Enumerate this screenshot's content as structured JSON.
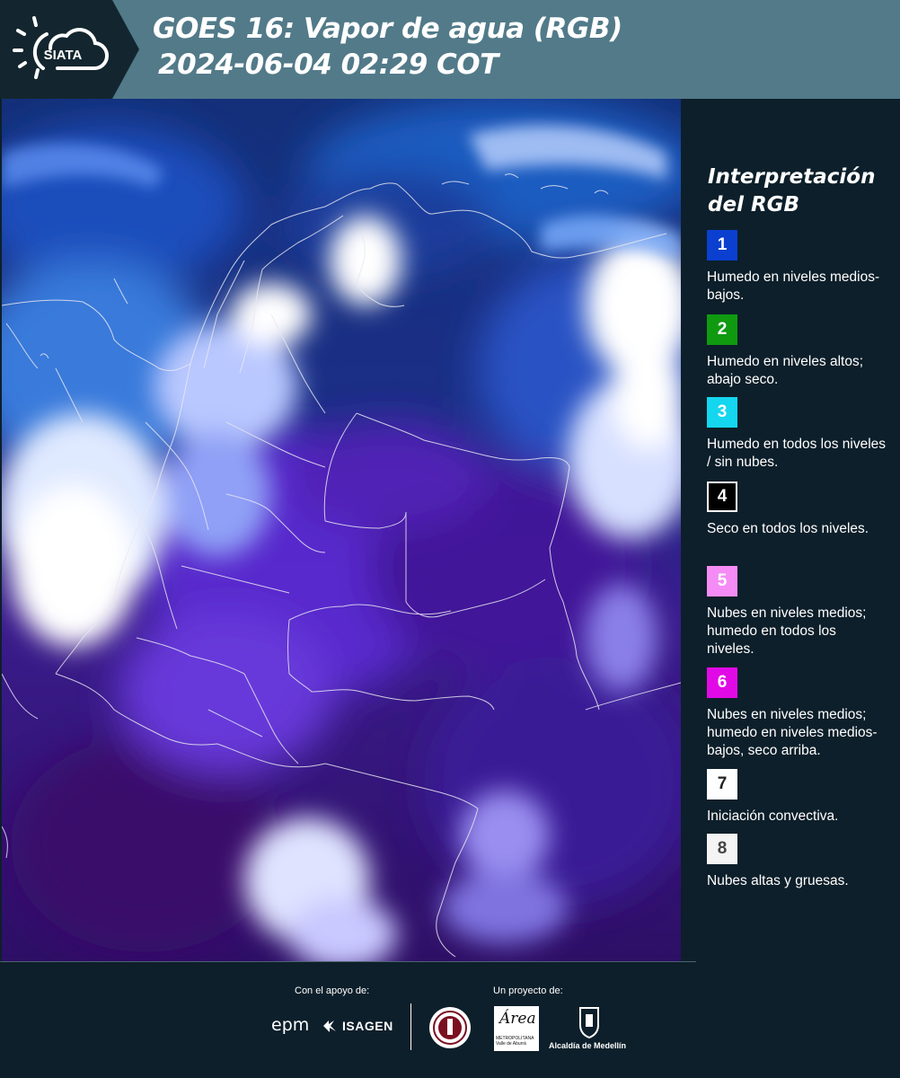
{
  "header": {
    "logo_text": "SIATA",
    "title": "GOES 16: Vapor de agua (RGB)",
    "subtitle": "2024-06-04 02:29 COT"
  },
  "legend": {
    "title_line1": "Interpretación",
    "title_line2": "del RGB",
    "items": [
      {
        "number": "1",
        "color": "#0a3fd0",
        "text_color": "#ffffff",
        "description": "Humedo en niveles medios-bajos."
      },
      {
        "number": "2",
        "color": "#0f9a10",
        "text_color": "#ffffff",
        "description": "Humedo en niveles altos; abajo seco."
      },
      {
        "number": "3",
        "color": "#14d6ef",
        "text_color": "#ffffff",
        "description": "Humedo en todos los niveles / sin nubes."
      },
      {
        "number": "4",
        "color": "#000000",
        "text_color": "#ffffff",
        "description": "Seco en todos los niveles."
      },
      {
        "number": "5",
        "color": "#f58cf5",
        "text_color": "#ffffff",
        "description": "Nubes en niveles medios; humedo en todos los niveles."
      },
      {
        "number": "6",
        "color": "#e10ae6",
        "text_color": "#ffffff",
        "description": "Nubes en niveles medios; humedo en niveles medios-bajos, seco arriba."
      },
      {
        "number": "7",
        "color": "#ffffff",
        "text_color": "#222222",
        "description": "Iniciación convectiva."
      },
      {
        "number": "8",
        "color": "#f4f4f4",
        "text_color": "#444444",
        "description": "Nubes altas y gruesas."
      }
    ]
  },
  "footer": {
    "support_label": "Con el apoyo de:",
    "project_label": "Un proyecto de:",
    "epm": "epm",
    "isagen": "ISAGEN",
    "area_script": "Área",
    "area_sub": "METROPOLITANA Valle de Aburrá",
    "alcaldia": "Alcaldía de Medellín"
  }
}
